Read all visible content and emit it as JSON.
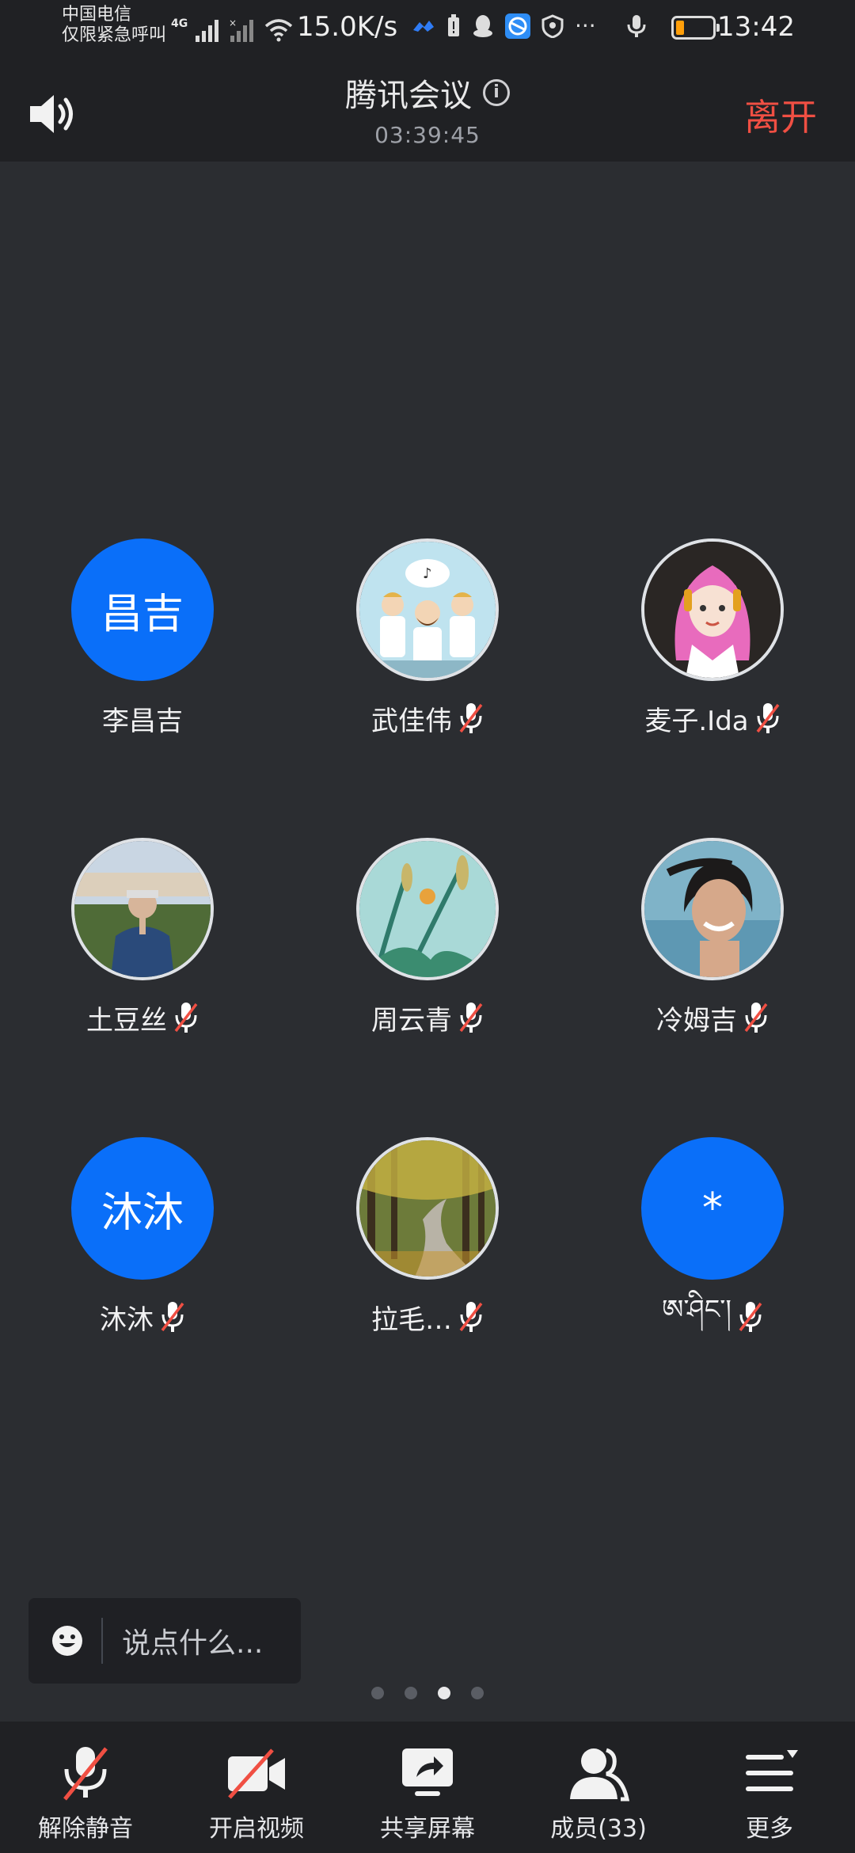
{
  "status_bar": {
    "carrier_line1": "中国电信",
    "carrier_line2": "仅限紧急呼叫",
    "network_type": "4G",
    "net_speed": "15.0K/s",
    "time": "13:42",
    "battery_color": "#ff9f0a"
  },
  "header": {
    "title": "腾讯会议",
    "timer": "03:39:45",
    "leave_label": "离开",
    "leave_color": "#f04f43"
  },
  "participants": [
    {
      "avatar_text": "昌吉",
      "name": "李昌吉",
      "muted": false,
      "avatar": "text"
    },
    {
      "avatar_text": "",
      "name": "武佳伟",
      "muted": true,
      "avatar": "cartoon-singers"
    },
    {
      "avatar_text": "",
      "name": "麦子.Ida",
      "muted": true,
      "avatar": "cartoon-girl"
    },
    {
      "avatar_text": "",
      "name": "土豆丝",
      "muted": true,
      "avatar": "photo-man"
    },
    {
      "avatar_text": "",
      "name": "周云青",
      "muted": true,
      "avatar": "illustration-plants"
    },
    {
      "avatar_text": "",
      "name": "冷姆吉",
      "muted": true,
      "avatar": "photo-woman"
    },
    {
      "avatar_text": "沐沐",
      "name": "沐沐",
      "muted": true,
      "avatar": "text"
    },
    {
      "avatar_text": "",
      "name": "拉毛…",
      "muted": true,
      "avatar": "photo-forest-path"
    },
    {
      "avatar_text": "*",
      "name": "ཨ་ཤིང་།",
      "muted": true,
      "avatar": "text"
    }
  ],
  "chat": {
    "placeholder": "说点什么..."
  },
  "pager": {
    "pages": 4,
    "active": 3
  },
  "toolbar": {
    "unmute_label": "解除静音",
    "video_label": "开启视频",
    "share_label": "共享屏幕",
    "members_label": "成员(33)",
    "more_label": "更多"
  },
  "colors": {
    "accent": "#0a6ff9",
    "background": "#2b2d31",
    "bar": "#202124",
    "mute_red": "#f04f43"
  }
}
